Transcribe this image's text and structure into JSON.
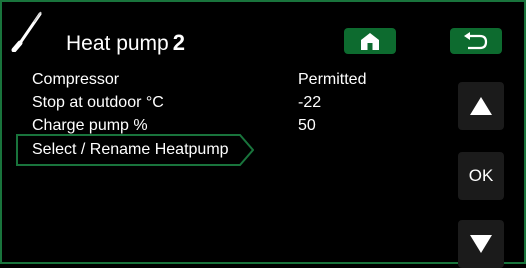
{
  "header": {
    "title": "Heat pump",
    "number": "2",
    "icons": {
      "device": "thermometer-probe-icon",
      "home": "home-icon",
      "back": "return-arrow-icon"
    }
  },
  "settings": [
    {
      "label": "Compressor",
      "value": "Permitted"
    },
    {
      "label": "Stop at outdoor °C",
      "value": "-22"
    },
    {
      "label": "Charge pump %",
      "value": "50"
    }
  ],
  "selected_item": {
    "label": "Select / Rename Heatpump"
  },
  "side_buttons": {
    "up_icon": "triangle-up-icon",
    "ok_label": "OK",
    "down_icon": "triangle-down-icon"
  },
  "colors": {
    "accent_green": "#0d6b2f",
    "frame_green": "#19743c",
    "button_dark": "#1b1b1b",
    "background": "#000000",
    "text": "#ffffff"
  }
}
